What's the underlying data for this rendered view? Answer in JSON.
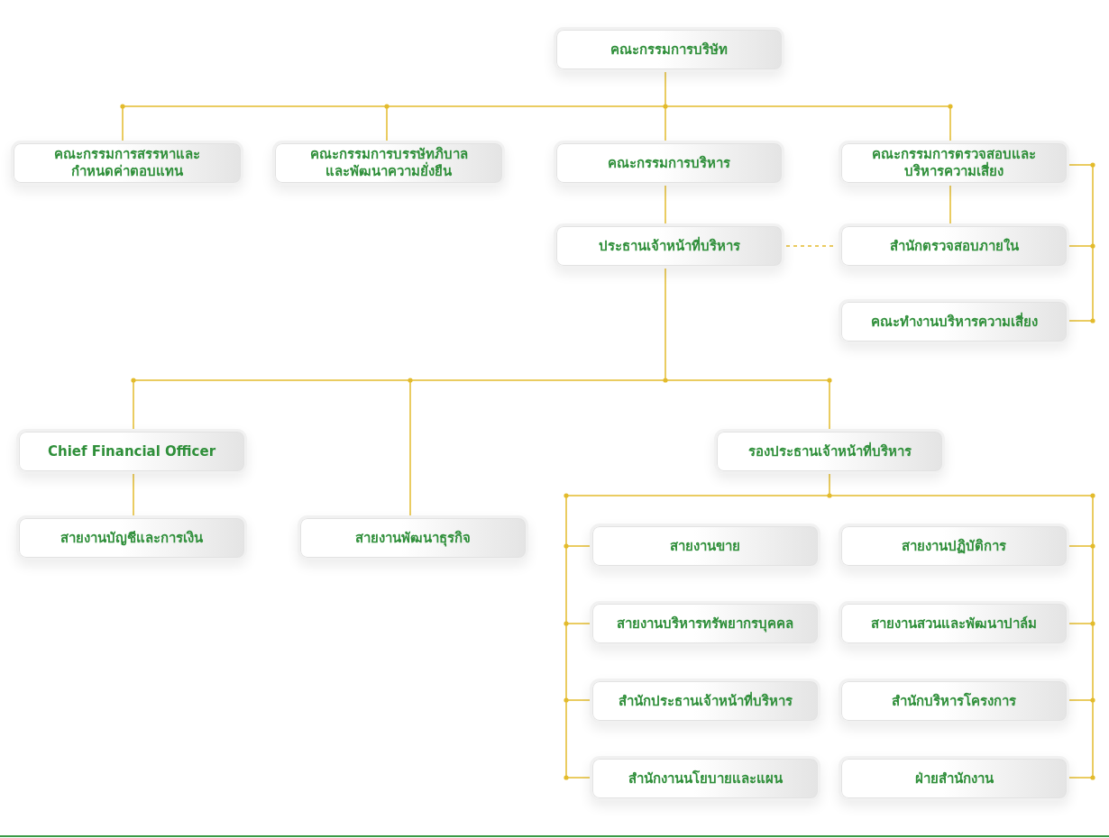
{
  "org_chart": {
    "nodes": [
      {
        "label": "คณะกรรมการบริษัท"
      },
      {
        "label": "คณะกรรมการสรรหาและ\nกำหนดค่าตอบแทน"
      },
      {
        "label": "คณะกรรมการบรรษัทภิบาล\nและพัฒนาความยั่งยืน"
      },
      {
        "label": "คณะกรรมการบริหาร"
      },
      {
        "label": "คณะกรรมการตรวจสอบและ\nบริหารความเสี่ยง"
      },
      {
        "label": "ประธานเจ้าหน้าที่บริหาร"
      },
      {
        "label": "สำนักตรวจสอบภายใน"
      },
      {
        "label": "คณะทำงานบริหารความเสี่ยง"
      },
      {
        "label": "Chief Financial Officer"
      },
      {
        "label": "รองประธานเจ้าหน้าที่บริหาร"
      },
      {
        "label": "สายงานบัญชีและการเงิน"
      },
      {
        "label": "สายงานพัฒนาธุรกิจ"
      },
      {
        "label": "สายงานขาย"
      },
      {
        "label": "สายงานปฏิบัติการ"
      },
      {
        "label": "สายงานบริหารทรัพยากรบุคคล"
      },
      {
        "label": "สายงานสวนและพัฒนาปาล์ม"
      },
      {
        "label": "สำนักประธานเจ้าหน้าที่บริหาร"
      },
      {
        "label": "สำนักบริหารโครงการ"
      },
      {
        "label": "สำนักงานนโยบายและแผน"
      },
      {
        "label": "ฝ่ายสำนักงาน"
      }
    ]
  }
}
